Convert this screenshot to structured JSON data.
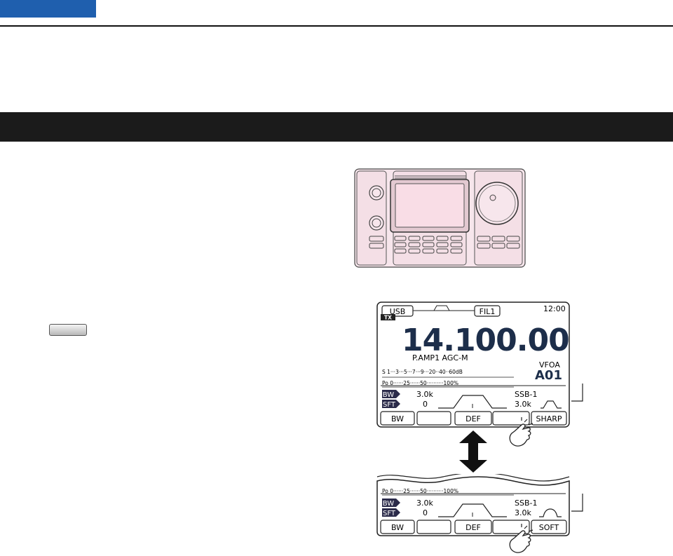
{
  "lcd1": {
    "mode": "USB",
    "filter": "FIL1",
    "clock": "12:00",
    "tx": "TX",
    "frequency": "14.100.00",
    "preamp_agc": "P.AMP1 AGC-M",
    "vfo": "VFOA",
    "memory": "A01",
    "s_scale": "S 1···3···5···7···9···20··40··60dB",
    "po_scale": "Po 0······25······50··········100%",
    "bw_label": "BW",
    "bw_value": "3.0k",
    "sft_label": "SFT",
    "sft_value": "0",
    "filter_type": "SSB-1",
    "filter_width": "3.0k",
    "softkeys": [
      "BW",
      "",
      "DEF",
      "",
      "SHARP"
    ]
  },
  "lcd2": {
    "po_scale": "Po 0······25······50··········100%",
    "bw_label": "BW",
    "bw_value": "3.0k",
    "sft_label": "SFT",
    "sft_value": "0",
    "filter_type": "SSB-1",
    "filter_width": "3.0k",
    "softkeys": [
      "BW",
      "",
      "DEF",
      "",
      "SOFT"
    ]
  },
  "colors": {
    "header_tab": "#1f5fae",
    "section_bar": "#1b1b1b",
    "radio_body": "#f7e6ec",
    "radio_screen": "#f9dde6"
  }
}
